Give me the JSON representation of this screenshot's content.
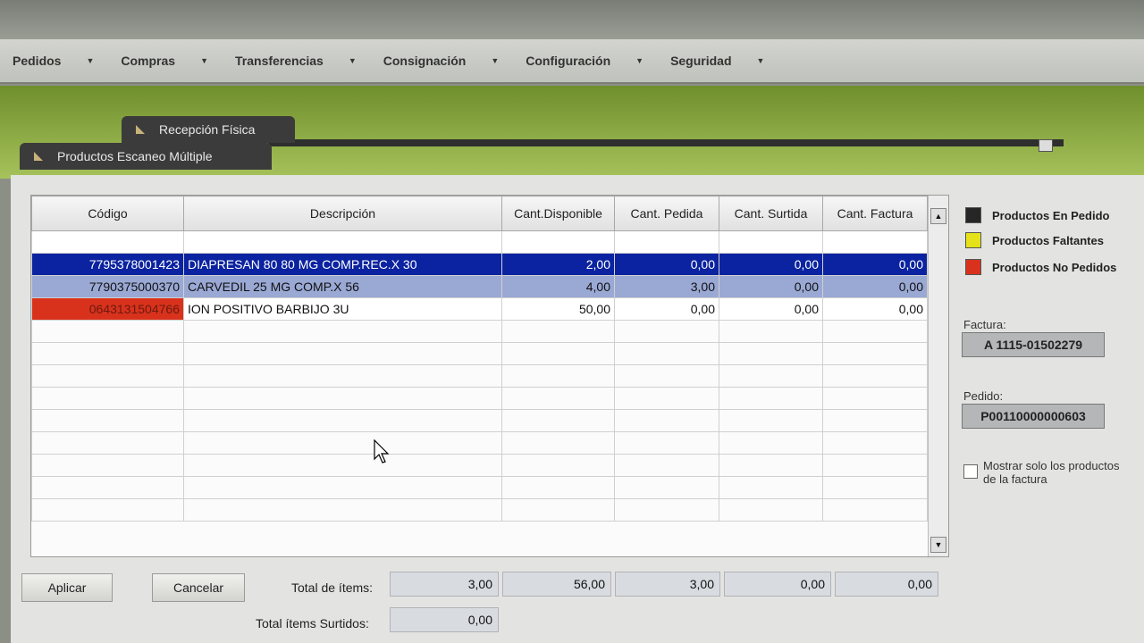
{
  "menu": [
    "Pedidos",
    "Compras",
    "Transferencias",
    "Consignación",
    "Configuración",
    "Seguridad"
  ],
  "tabs": {
    "reception": "Recepción Física",
    "scan": "Productos Escaneo Múltiple"
  },
  "grid": {
    "headers": [
      "Código",
      "Descripción",
      "Cant.Disponible",
      "Cant. Pedida",
      "Cant. Surtida",
      "Cant. Factura"
    ],
    "rows": [
      {
        "code": "7795378001423",
        "desc": "DIAPRESAN 80 80 MG COMP.REC.X 30",
        "disp": "2,00",
        "ped": "0,00",
        "surt": "0,00",
        "fact": "0,00"
      },
      {
        "code": "7790375000370",
        "desc": "CARVEDIL 25 MG COMP.X 56",
        "disp": "4,00",
        "ped": "3,00",
        "surt": "0,00",
        "fact": "0,00"
      },
      {
        "code": "0643131504766",
        "desc": "ION POSITIVO BARBIJO 3U",
        "disp": "50,00",
        "ped": "0,00",
        "surt": "0,00",
        "fact": "0,00"
      }
    ]
  },
  "legend": [
    {
      "label": "Productos En Pedido",
      "color": "#262626"
    },
    {
      "label": "Productos Faltantes",
      "color": "#e6e21a"
    },
    {
      "label": "Productos No Pedidos",
      "color": "#d9321c"
    }
  ],
  "factura": {
    "label": "Factura:",
    "value": "A 1115-01502279"
  },
  "pedido": {
    "label": "Pedido:",
    "value": "P00110000000603"
  },
  "checkbox_label": "Mostrar solo los productos de la factura",
  "buttons": {
    "apply": "Aplicar",
    "cancel": "Cancelar"
  },
  "totals": {
    "items_label": "Total de ítems:",
    "items": [
      "3,00",
      "56,00",
      "3,00",
      "0,00",
      "0,00"
    ],
    "surtidos_label": "Total ítems Surtidos:",
    "surtidos": "0,00"
  }
}
